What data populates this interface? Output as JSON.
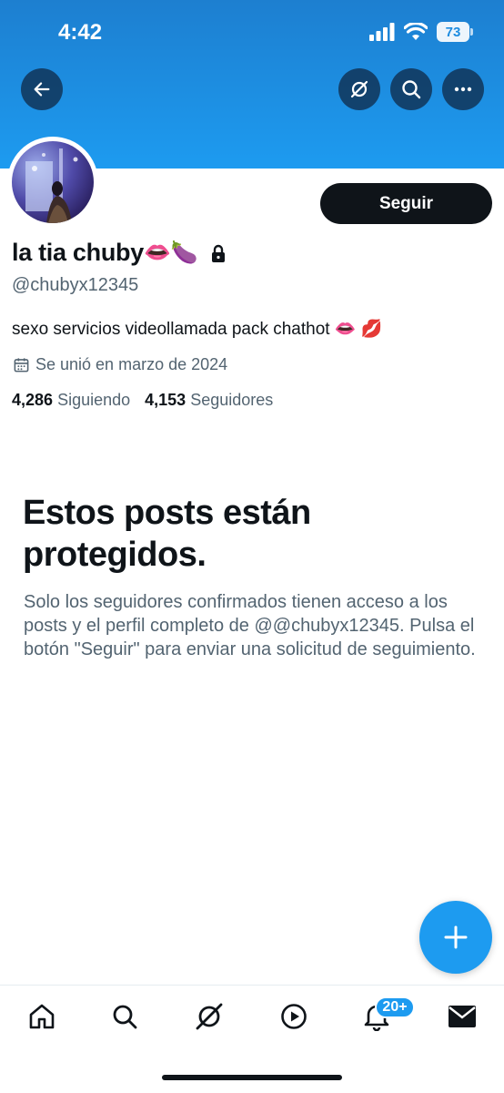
{
  "status_bar": {
    "time": "4:42",
    "battery": "73"
  },
  "profile": {
    "name": "la tia chuby",
    "name_emojis": "👄🍆",
    "handle": "@chubyx12345",
    "bio": "sexo servicios videollamada pack chathot 👄 💋",
    "joined": "Se unió en marzo de 2024",
    "following_count": "4,286",
    "following_label": "Siguiendo",
    "followers_count": "4,153",
    "followers_label": "Seguidores",
    "follow_label": "Seguir"
  },
  "protected": {
    "title": "Estos posts están protegidos.",
    "text": "Solo los seguidores confirmados tienen acceso a los posts y el perfil completo de @@chubyx12345. Pulsa el botón \"Seguir\" para enviar una solicitud de seguimiento."
  },
  "tabbar": {
    "notifications_badge": "20+"
  },
  "icons": [
    "back-arrow-icon",
    "grok-icon",
    "search-icon",
    "more-icon",
    "lock-icon",
    "calendar-icon",
    "plus-icon",
    "home-icon",
    "explore-icon",
    "grok-tab-icon",
    "video-icon",
    "bell-icon",
    "mail-icon"
  ],
  "colors": {
    "accent": "#1d9bf0",
    "text": "#0f1419",
    "secondary": "#536471"
  }
}
